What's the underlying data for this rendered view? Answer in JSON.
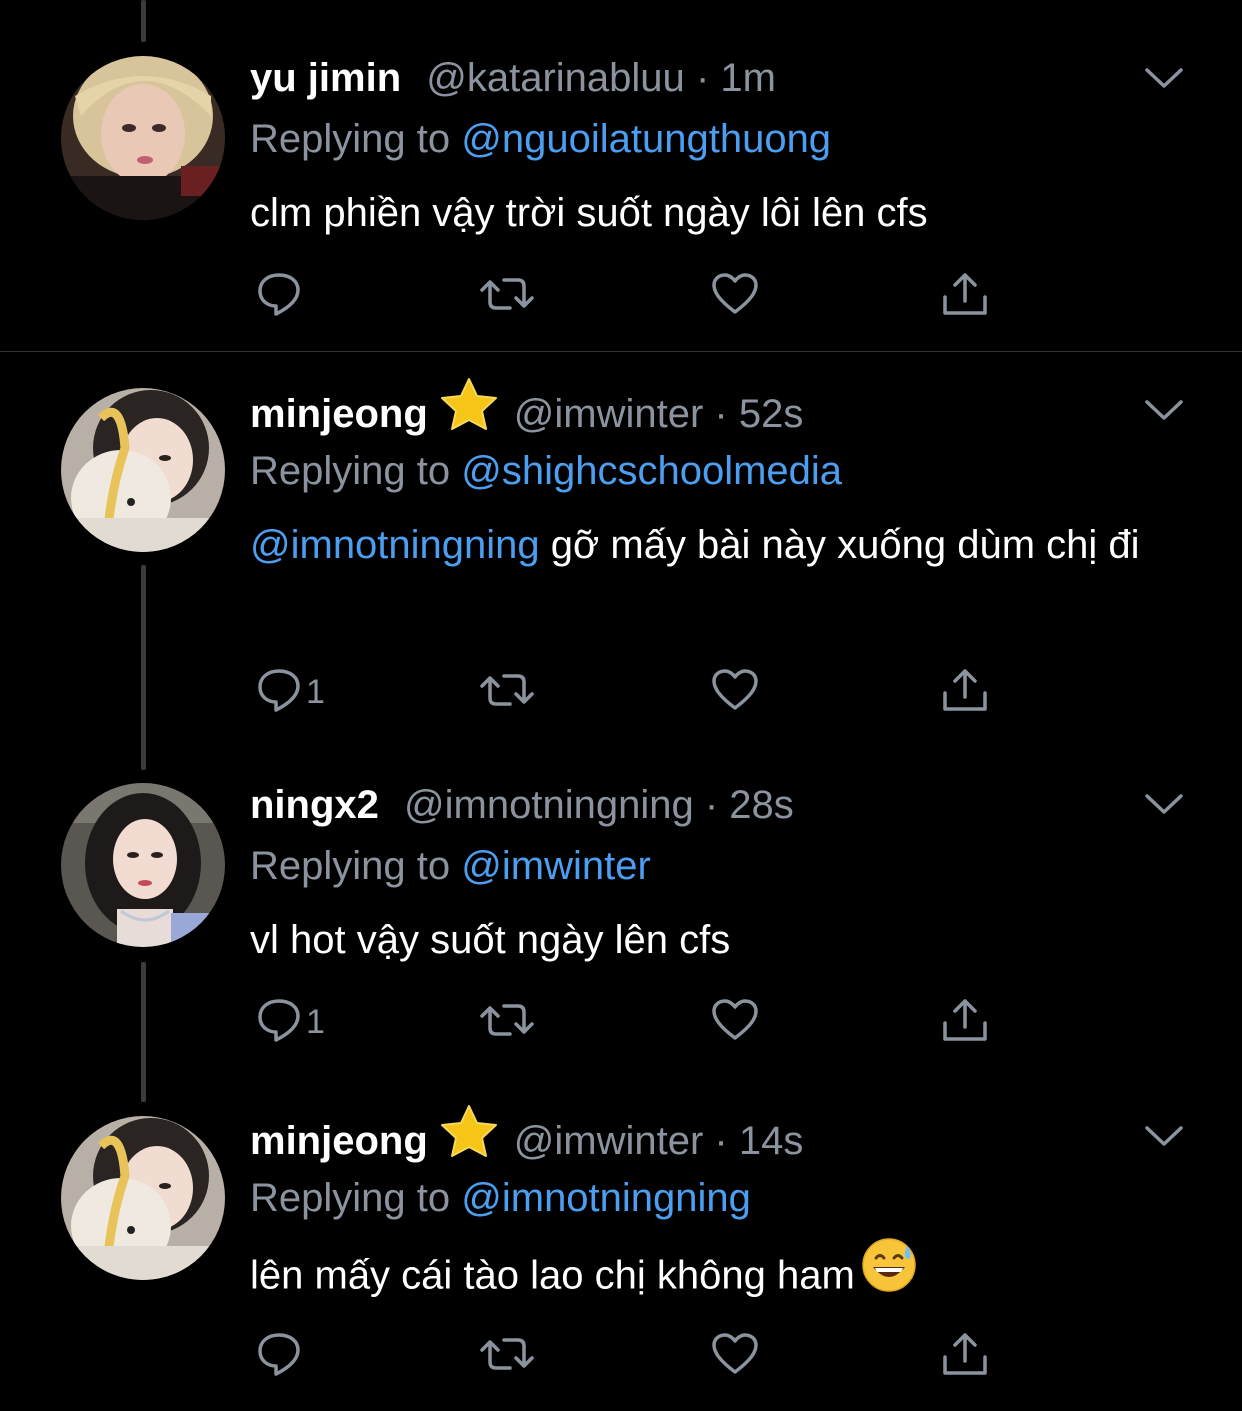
{
  "tweets": [
    {
      "name": "yu jimin",
      "handle": "@katarinabluu",
      "separator": "·",
      "time": "1m",
      "reply_prefix": "Replying to",
      "reply_to": "@nguoilatungthuong",
      "text_mention": "",
      "text": "clm phiền vậy trời suốt ngày lôi lên cfs",
      "reply_count": "",
      "verified_star": false
    },
    {
      "name": "minjeong",
      "handle": "@imwinter",
      "separator": "·",
      "time": "52s",
      "reply_prefix": "Replying to",
      "reply_to": "@shighcschoolmedia",
      "text_mention": "@imnotningning",
      "text": " gỡ mấy bài này xuống dùm chị đi",
      "reply_count": "1",
      "verified_star": true
    },
    {
      "name": "ningx2",
      "handle": "@imnotningning",
      "separator": "·",
      "time": "28s",
      "reply_prefix": "Replying to",
      "reply_to": "@imwinter",
      "text_mention": "",
      "text": "vl hot vậy suốt ngày lên cfs",
      "reply_count": "1",
      "verified_star": false
    },
    {
      "name": "minjeong",
      "handle": "@imwinter",
      "separator": "·",
      "time": "14s",
      "reply_prefix": "Replying to",
      "reply_to": "@imnotningning",
      "text_mention": "",
      "text": "lên mấy cái tào lao chị không ham",
      "reply_count": "",
      "verified_star": true,
      "trailing_emoji": "grinning-face-with-sweat-icon"
    }
  ],
  "icons": {
    "reply": "reply-icon",
    "retweet": "retweet-icon",
    "like": "like-icon",
    "share": "share-icon",
    "more": "chevron-down-icon",
    "star": "star-icon"
  },
  "colors": {
    "background": "#000000",
    "text": "#ffffff",
    "muted": "#8b949e",
    "mention": "#4c9ef0",
    "divider": "#2f3336",
    "thread_line": "#3a3b3e"
  }
}
